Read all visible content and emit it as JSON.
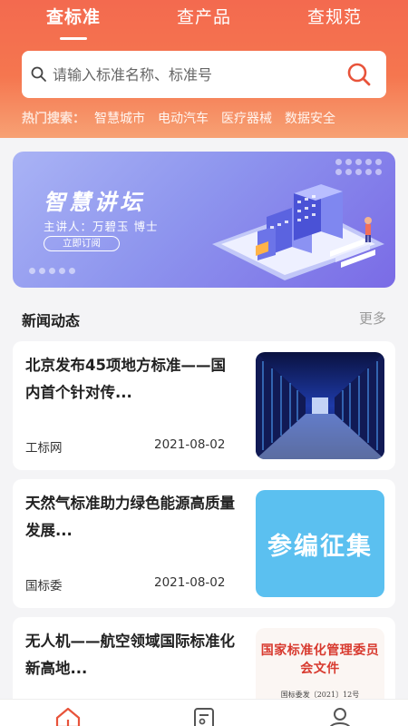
{
  "tabs": [
    {
      "label": "查标准",
      "active": true
    },
    {
      "label": "查产品",
      "active": false
    },
    {
      "label": "查规范",
      "active": false
    }
  ],
  "search": {
    "placeholder": "请输入标准名称、标准号",
    "value": ""
  },
  "hot_search": {
    "label": "热门搜索：",
    "items": [
      "智慧城市",
      "电动汽车",
      "医疗器械",
      "数据安全"
    ]
  },
  "banner": {
    "title": "智慧讲坛",
    "subtitle": "主讲人：万碧玉  博士",
    "button_label": "立即订阅"
  },
  "news_section": {
    "title": "新闻动态",
    "more_label": "更多"
  },
  "news": [
    {
      "title": "北京发布45项地方标准——国内首个针对传...",
      "source": "工标网",
      "date": "2021-08-02",
      "thumb": "datacenter-image"
    },
    {
      "title": "天然气标准助力绿色能源高质量发展...",
      "source": "国标委",
      "date": "2021-08-02",
      "thumb": "text-image",
      "thumb_text": "参编征集"
    },
    {
      "title": "无人机——航空领域国际标准化新高地...",
      "source": "",
      "date": "",
      "thumb": "document-image",
      "thumb_heading": "国家标准化管理委员会文件",
      "thumb_number": "国标委发〔2021〕12号"
    }
  ],
  "bottom_nav": [
    {
      "icon": "home-icon",
      "active": true
    },
    {
      "icon": "document-icon",
      "active": false
    },
    {
      "icon": "user-icon",
      "active": false
    }
  ],
  "colors": {
    "accent": "#f36a4f",
    "banner": "#8e95ee",
    "thumb_cyan": "#5bc0f0",
    "doc_red": "#d83a2f"
  }
}
